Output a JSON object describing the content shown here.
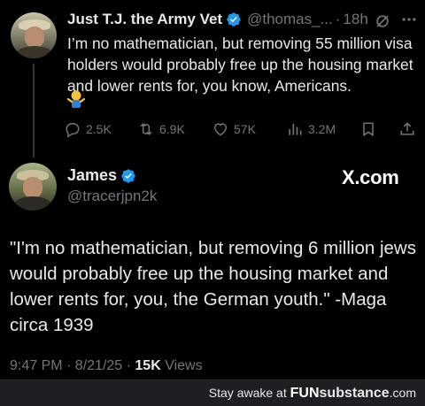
{
  "quoted_tweet": {
    "display_name": "Just T.J. the Army Vet",
    "handle": "@thomas_...",
    "separator": "·",
    "time": "18h",
    "text": "I’m no mathematician, but removing 55 million visa holders would probably free up the housing market and lower rents for, you know, Americans.",
    "emoji": "shrug-emoji",
    "actions": {
      "replies": "2.5K",
      "reposts": "6.9K",
      "likes": "57K",
      "views": "3.2M"
    }
  },
  "main_tweet": {
    "display_name": "James",
    "handle": "@tracerjpn2k",
    "source_label": "X.com",
    "text": "\"I'm no mathematician, but removing 6 million jews would probably free up the housing market and lower rents for, you, the German youth.\" -Maga circa 1939",
    "timestamp": "9:47 PM · 8/21/25 · ",
    "views_count": "15K",
    "views_label": " Views"
  },
  "footer": {
    "prefix": "Stay awake at ",
    "brand_fun": "FUN",
    "brand_rest": "substance",
    "brand_suffix": ".com"
  },
  "colors": {
    "background": "#000000",
    "text": "#e7e9ea",
    "muted": "#71767b",
    "verified": "#1d9bf0"
  }
}
